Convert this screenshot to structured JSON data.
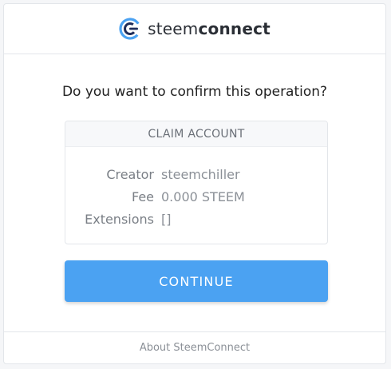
{
  "brand": {
    "name_regular": "steem",
    "name_bold": "connect",
    "logo_icon": "steemconnect-logo-icon",
    "accent_color": "#4ba2f2"
  },
  "question": "Do you want to confirm this operation?",
  "operation": {
    "title": "CLAIM ACCOUNT",
    "fields": [
      {
        "key": "Creator",
        "value": "steemchiller"
      },
      {
        "key": "Fee",
        "value": "0.000 STEEM"
      },
      {
        "key": "Extensions",
        "value": "[]"
      }
    ]
  },
  "continue_button": {
    "label": "CONTINUE"
  },
  "footer": {
    "link_label": "About SteemConnect"
  }
}
